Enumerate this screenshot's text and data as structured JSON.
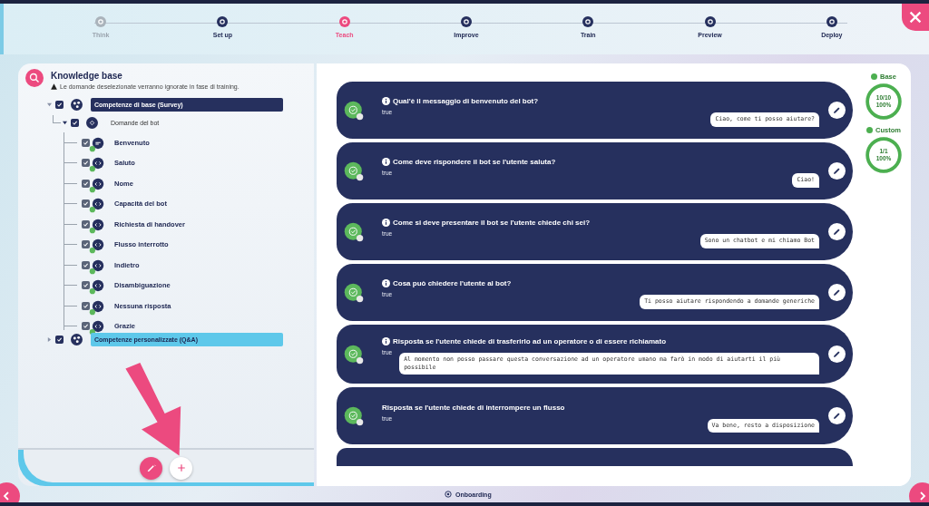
{
  "steps": [
    {
      "label": "Think",
      "selected": false,
      "disabled": true
    },
    {
      "label": "Set up",
      "selected": false,
      "disabled": false
    },
    {
      "label": "Teach",
      "selected": true,
      "disabled": false
    },
    {
      "label": "Improve",
      "selected": false,
      "disabled": false
    },
    {
      "label": "Train",
      "selected": false,
      "disabled": false
    },
    {
      "label": "Preview",
      "selected": false,
      "disabled": false
    },
    {
      "label": "Deploy",
      "selected": false,
      "disabled": false
    }
  ],
  "knowledge_base": {
    "title": "Knowledge base",
    "notice": "Le domande deselezionate verranno ignorate in fase di training.",
    "tree": [
      {
        "label": "Competenze di base (Survey)",
        "checked": true,
        "expanded": true,
        "color": "#26305e",
        "children": [
          {
            "label": "Domande del bot",
            "checked": true,
            "expanded": true,
            "children": [
              {
                "label": "Benvenuto",
                "checked": true,
                "kind": "text"
              },
              {
                "label": "Saluto",
                "checked": true,
                "kind": "code"
              },
              {
                "label": "Nome",
                "checked": true,
                "kind": "code"
              },
              {
                "label": "Capacità del bot",
                "checked": true,
                "kind": "code"
              },
              {
                "label": "Richiesta di handover",
                "checked": true,
                "kind": "code"
              },
              {
                "label": "Flusso interrotto",
                "checked": true,
                "kind": "code"
              },
              {
                "label": "Indietro",
                "checked": true,
                "kind": "code"
              },
              {
                "label": "Disambiguazione",
                "checked": true,
                "kind": "code"
              },
              {
                "label": "Nessuna risposta",
                "checked": true,
                "kind": "code"
              },
              {
                "label": "Grazie",
                "checked": true,
                "kind": "code"
              }
            ]
          }
        ]
      },
      {
        "label": "Competenze personalizzate (Q&A)",
        "checked": true,
        "expanded": false,
        "color": "#5ec8ea"
      }
    ]
  },
  "cards": [
    {
      "question": "Qual'è il messaggio di benvenuto del bot?",
      "info": true,
      "value": "true",
      "answer": "Ciao, come ti posso aiutare?"
    },
    {
      "question": "Come deve rispondere il bot se l'utente saluta?",
      "info": true,
      "value": "true",
      "answer": "Ciao!"
    },
    {
      "question": "Come si deve presentare il bot se l'utente chiede chi sei?",
      "info": true,
      "value": "true",
      "answer": "Sono un chatbot e mi chiamo Bot"
    },
    {
      "question": "Cosa può chiedere l'utente al bot?",
      "info": true,
      "value": "true",
      "answer": "Ti posso aiutare rispondendo a domande generiche"
    },
    {
      "question": "Risposta se l'utente chiede di trasferirlo ad un operatore o di essere richiamato",
      "info": true,
      "value": "true",
      "answer": "Al momento non posso passare questa conversazione ad un operatore umano ma farò in modo di aiutarti il più possibile"
    },
    {
      "question": "Risposta se l'utente chiede di interrompere un flusso",
      "info": false,
      "value": "true",
      "answer": "Va bene, resto a disposizione"
    }
  ],
  "stats": [
    {
      "label": "Base",
      "count": "10/10",
      "percent": "100%",
      "level": 1
    },
    {
      "label": "Custom",
      "count": "1/1",
      "percent": "100%",
      "level": 1
    }
  ],
  "footer": {
    "label": "Onboarding"
  }
}
